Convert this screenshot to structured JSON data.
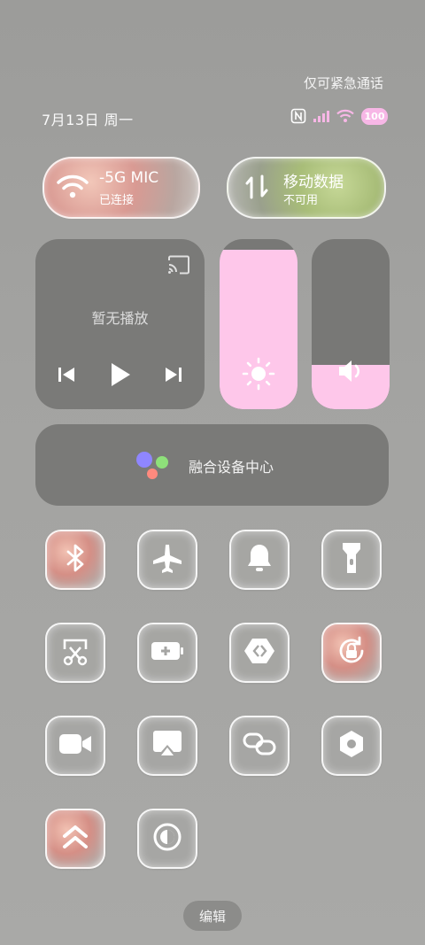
{
  "status_bar": {
    "emergency_text": "仅可紧急通话",
    "date_text": "7月13日 周一",
    "battery_level": "100"
  },
  "connectivity": {
    "wifi": {
      "title": "-5G   MIC",
      "status": "已连接"
    },
    "mobile_data": {
      "title": "移动数据",
      "status": "不可用"
    }
  },
  "media": {
    "status": "暂无播放"
  },
  "sliders": {
    "brightness_level": 0.94,
    "volume_level": 0.26
  },
  "fusion": {
    "label": "融合设备中心"
  },
  "toggles": [
    {
      "icon": "bluetooth-icon",
      "active": true
    },
    {
      "icon": "airplane-icon",
      "active": false
    },
    {
      "icon": "bell-icon",
      "active": false
    },
    {
      "icon": "flashlight-icon",
      "active": false
    },
    {
      "icon": "screenshot-icon",
      "active": false
    },
    {
      "icon": "battery-saver-icon",
      "active": false
    },
    {
      "icon": "multi-screen-icon",
      "active": false
    },
    {
      "icon": "rotation-lock-icon",
      "active": true
    },
    {
      "icon": "video-icon",
      "active": false
    },
    {
      "icon": "screen-cast-icon",
      "active": false
    },
    {
      "icon": "link-icon",
      "active": false
    },
    {
      "icon": "nut-icon",
      "active": false
    },
    {
      "icon": "ultra-power-icon",
      "active": true
    },
    {
      "icon": "dark-mode-icon",
      "active": false
    }
  ],
  "footer": {
    "edit_label": "编辑"
  },
  "colors": {
    "accent_pink": "#fec7ea",
    "card_gray": "#7a7a78"
  }
}
